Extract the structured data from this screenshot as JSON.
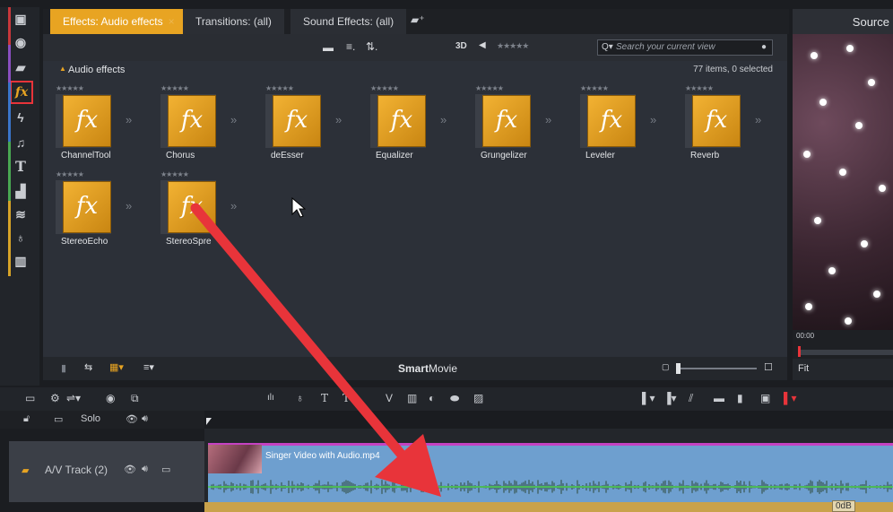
{
  "tabs": [
    {
      "label": "Effects: Audio effects",
      "active": true,
      "close": "×"
    },
    {
      "label": "Transitions: (all)",
      "active": false
    },
    {
      "label": "Sound Effects: (all)",
      "active": false
    }
  ],
  "toolbar": {
    "view_3d": "3D",
    "rating_filter": "★★★★★",
    "search_placeholder": "Search your current view"
  },
  "library": {
    "section_title": "Audio effects",
    "count_text": "77 items, 0 selected",
    "items": [
      {
        "label": "ChannelTool",
        "stars": "★★★★★"
      },
      {
        "label": "Chorus",
        "stars": "★★★★★"
      },
      {
        "label": "deEsser",
        "stars": "★★★★★"
      },
      {
        "label": "Equalizer",
        "stars": "★★★★★"
      },
      {
        "label": "Grungelizer",
        "stars": "★★★★★"
      },
      {
        "label": "Leveler",
        "stars": "★★★★★"
      },
      {
        "label": "Reverb",
        "stars": "★★★★★"
      },
      {
        "label": "StereoEcho",
        "stars": "★★★★★"
      },
      {
        "label": "StereoSpre",
        "stars": "★★★★★"
      }
    ],
    "tile_glyph": "fx",
    "bottom_title_bold": "Smart",
    "bottom_title_rest": "Movie"
  },
  "preview": {
    "title": "Source",
    "timecode": "00:00",
    "fit_label": "Fit"
  },
  "timeline": {
    "solo_label": "Solo",
    "track_name": "A/V Track (2)",
    "clip_name": "Singer Video with Audio.mp4",
    "level_label": "0dB"
  },
  "colors": {
    "accent": "#e8a422",
    "highlight_box": "#e8343a",
    "arrow": "#e8343a",
    "clip_blue": "#6e9fcf",
    "waveform_green": "#4bd04b"
  },
  "icons": [
    "library-icon",
    "disc-icon",
    "folder-icon",
    "fx-icon",
    "lightning-icon",
    "music-note-icon",
    "title-icon",
    "brush-icon",
    "layers-icon",
    "clef-icon",
    "piano-icon"
  ]
}
